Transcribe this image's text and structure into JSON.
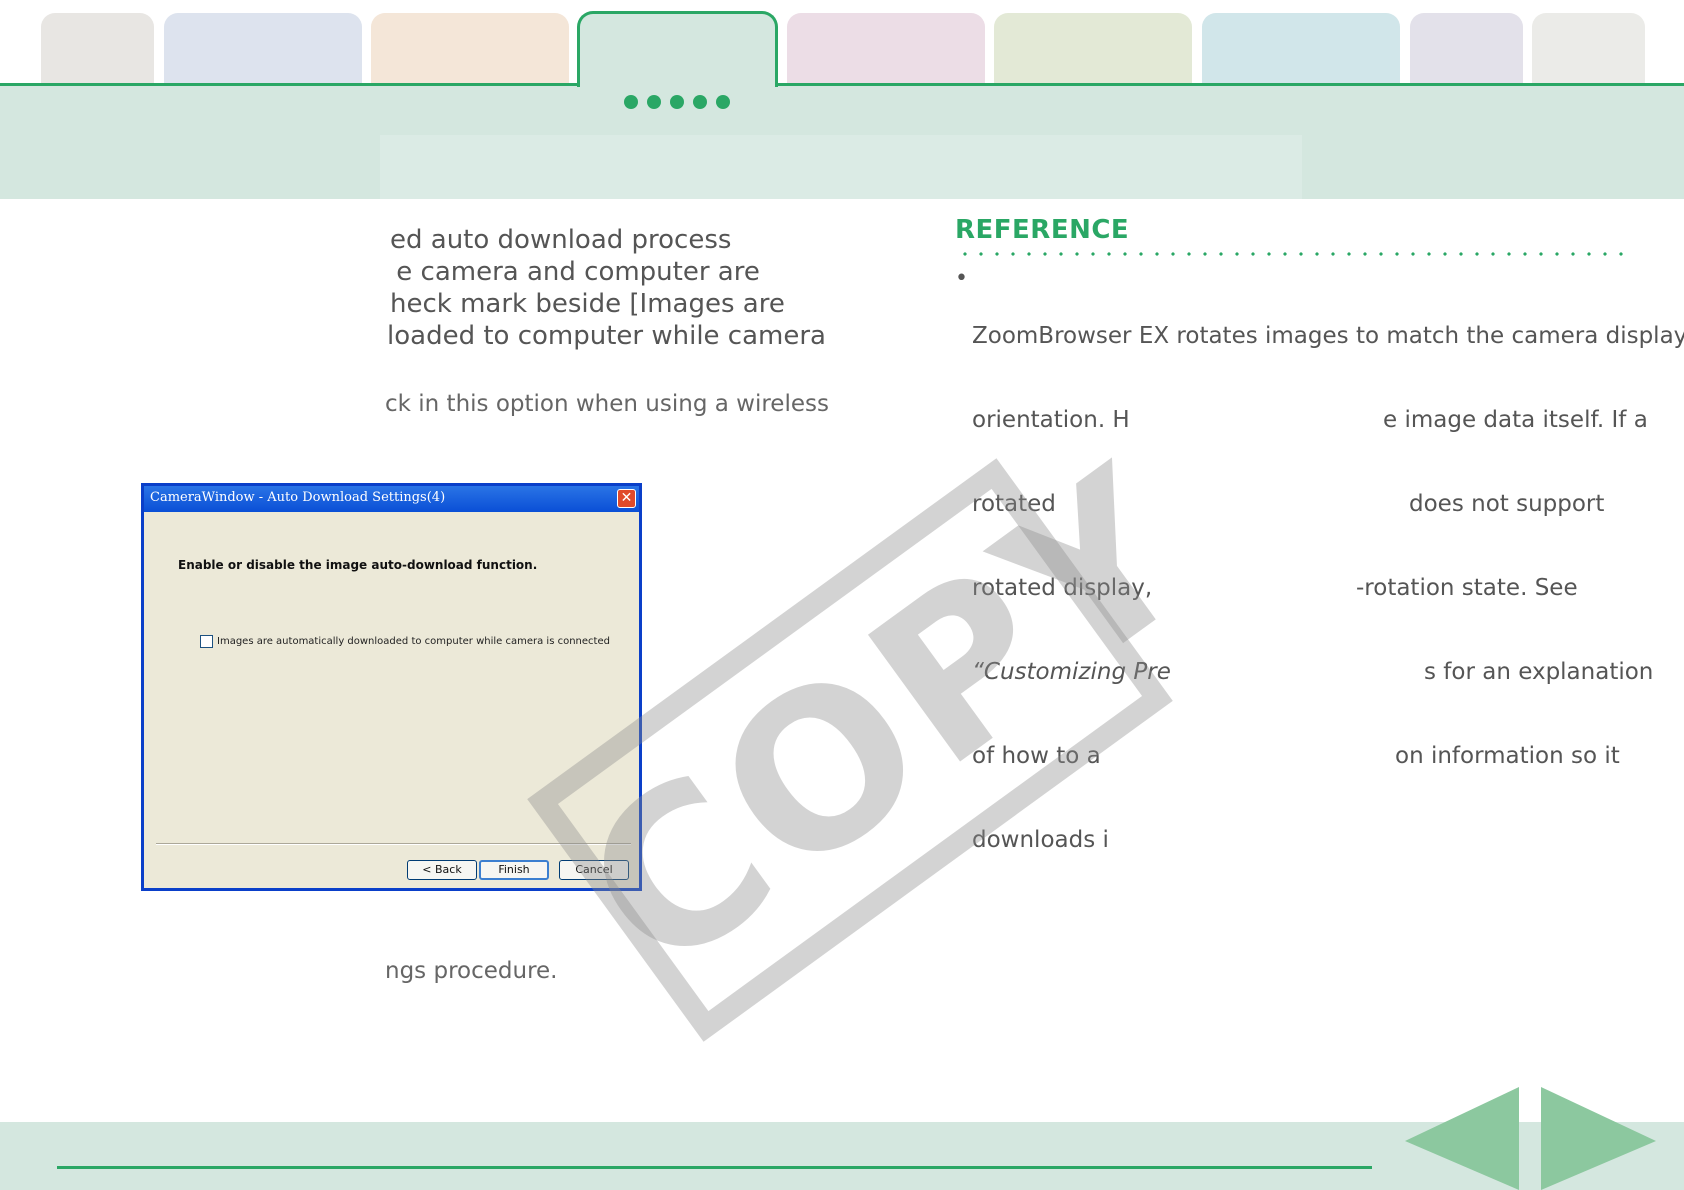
{
  "tabs": [
    {
      "name": "tab-1",
      "color": "#e8e6e3"
    },
    {
      "name": "tab-2",
      "color": "#dde3ee"
    },
    {
      "name": "tab-3",
      "color": "#f4e6d8"
    },
    {
      "name": "tab-4-active",
      "color": "#d4e7df"
    },
    {
      "name": "tab-5",
      "color": "#ecdde6"
    },
    {
      "name": "tab-6",
      "color": "#e3e9d6"
    },
    {
      "name": "tab-7",
      "color": "#d1e6ea"
    },
    {
      "name": "tab-8",
      "color": "#e3e1ea"
    },
    {
      "name": "tab-9",
      "color": "#ebebe8"
    }
  ],
  "body": {
    "lead_lines": [
      "ed auto download process",
      " e camera and computer are",
      "heck mark beside [Images are",
      "loaded to computer while camera"
    ],
    "note": "ck in this option when using a wireless",
    "footer_note": "ngs procedure."
  },
  "reference": {
    "title": "REFERENCE",
    "bullet": "•",
    "lines": [
      {
        "a": "ZoomBrowser EX rotates images to match the camera display",
        "b": ""
      },
      {
        "a": "orientation. H",
        "b": "e image data itself. If a"
      },
      {
        "a": "rotated",
        "b": "does not support"
      },
      {
        "a": "rotated display,",
        "b": "-rotation state. See"
      },
      {
        "a": "“Customizing Pre",
        "b": "s for an explanation"
      },
      {
        "a": "of how to a",
        "b": "on information so it"
      },
      {
        "a": "downloads i",
        "b": ""
      }
    ]
  },
  "dialog": {
    "title": "CameraWindow - Auto Download Settings(4)",
    "close": "✕",
    "heading": "Enable or disable the image auto-download function.",
    "checkbox_label": "Images are automatically downloaded to computer while camera is connected",
    "checkbox_checked": false,
    "buttons": {
      "back": "< Back",
      "finish": "Finish",
      "cancel": "Cancel"
    }
  },
  "watermark": "COPY",
  "colors": {
    "accent": "#2aa765",
    "band": "#d4e7df",
    "nav_arrow": "#8cc89f"
  },
  "icons": {
    "prev": "triangle-left-icon",
    "next": "triangle-right-icon"
  }
}
